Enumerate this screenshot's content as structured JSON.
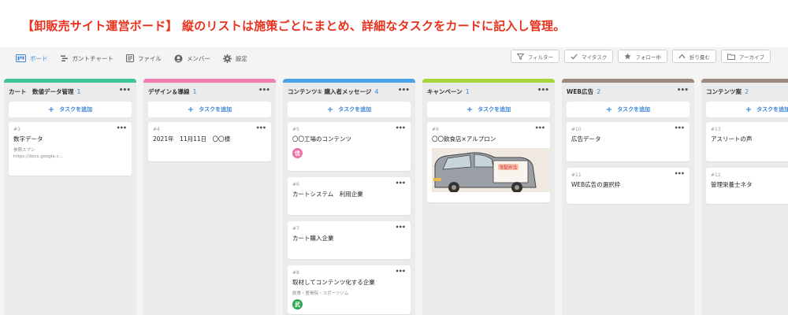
{
  "banner": {
    "text": "【卸販売サイト運営ボード】 縦のリストは施策ごとにまとめ、詳細なタスクをカードに記入し管理。"
  },
  "tabs": [
    {
      "label": "ボード",
      "icon": "board-icon",
      "active": true
    },
    {
      "label": "ガントチャート",
      "icon": "gantt-icon",
      "active": false
    },
    {
      "label": "ファイル",
      "icon": "file-icon",
      "active": false
    },
    {
      "label": "メンバー",
      "icon": "members-icon",
      "active": false
    },
    {
      "label": "設定",
      "icon": "gear-icon",
      "active": false
    }
  ],
  "actions": [
    {
      "label": "フィルター",
      "icon": "filter-icon"
    },
    {
      "label": "マイタスク",
      "icon": "check-icon"
    },
    {
      "label": "フォロー中",
      "icon": "star-icon"
    },
    {
      "label": "折り畳む",
      "icon": "chevron-up-icon"
    },
    {
      "label": "アーカイブ",
      "icon": "folder-icon"
    }
  ],
  "add_task_label": "タスクを追加",
  "colors": {
    "accent": "#3a86d8",
    "banner": "#e8321e"
  },
  "columns": [
    {
      "title": "カート　数値データ管理",
      "count": "1",
      "color": "#3cc39a",
      "cards": [
        {
          "id": "#3",
          "title": "数字データ",
          "note1": "参照スプシ",
          "note2": "https://docs.google.c..."
        }
      ]
    },
    {
      "title": "デザイン＆導線",
      "count": "1",
      "color": "#f27bb1",
      "cards": [
        {
          "id": "#4",
          "title": "2021年　11月11日　〇〇様"
        }
      ]
    },
    {
      "title": "コンテンツ① 購入者メッセージ",
      "count": "4",
      "color": "#4aa3e8",
      "cards": [
        {
          "id": "#5",
          "title": "〇〇工場のコンテンツ",
          "avatar": "佳",
          "avatar_color": "#f06fa7"
        },
        {
          "id": "#6",
          "title": "カートシステム　利用企業"
        },
        {
          "id": "#7",
          "title": "カート購入企業"
        },
        {
          "id": "#8",
          "title": "取材してコンテンツ化する企業",
          "note1": "飲食・整骨院・スポーツジム",
          "avatar": "武",
          "avatar_color": "#2ea84f"
        }
      ]
    },
    {
      "title": "キャンペーン",
      "count": "1",
      "color": "#a8d43c",
      "cards": [
        {
          "id": "#9",
          "title": "〇〇飲食店×アルプロン",
          "image": "delivery-van-illustration"
        }
      ]
    },
    {
      "title": "WEB広告",
      "count": "2",
      "color": "#9a8a80",
      "cards": [
        {
          "id": "#10",
          "title": "広告データ"
        },
        {
          "id": "#11",
          "title": "WEB広告の選択枠"
        }
      ]
    },
    {
      "title": "コンテンツ案",
      "count": "2",
      "color": "#9a8a80",
      "cards": [
        {
          "id": "#13",
          "title": "アスリートの声"
        },
        {
          "id": "#12",
          "title": "管理栄養士ネタ"
        }
      ]
    }
  ]
}
